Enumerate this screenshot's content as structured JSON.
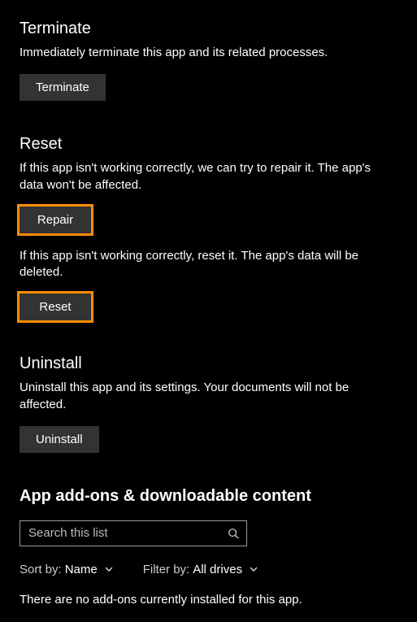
{
  "terminate": {
    "heading": "Terminate",
    "description": "Immediately terminate this app and its related processes.",
    "button_label": "Terminate"
  },
  "reset": {
    "heading": "Reset",
    "repair_description": "If this app isn't working correctly, we can try to repair it. The app's data won't be affected.",
    "repair_button_label": "Repair",
    "reset_description": "If this app isn't working correctly, reset it. The app's data will be deleted.",
    "reset_button_label": "Reset"
  },
  "uninstall": {
    "heading": "Uninstall",
    "description": "Uninstall this app and its settings. Your documents will not be affected.",
    "button_label": "Uninstall"
  },
  "addons": {
    "heading": "App add-ons & downloadable content",
    "search_placeholder": "Search this list",
    "sort_label": "Sort by:",
    "sort_value": "Name",
    "filter_label": "Filter by:",
    "filter_value": "All drives",
    "empty_state": "There are no add-ons currently installed for this app."
  }
}
